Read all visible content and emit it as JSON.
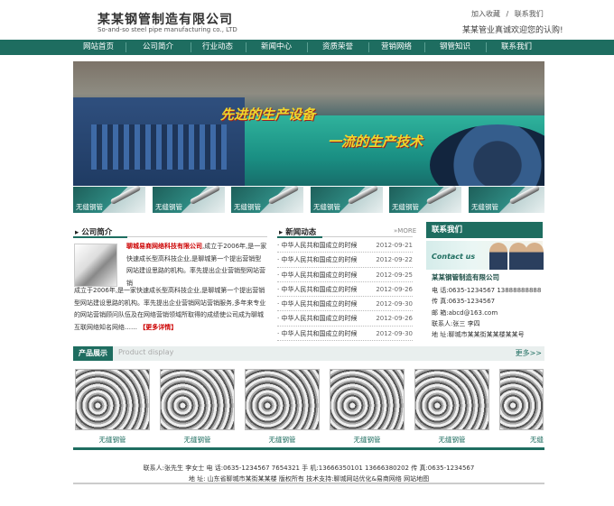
{
  "header": {
    "logo_cn": "某某钢管制造有限公司",
    "logo_en": "So-and-so steel pipe manufacturing co., LTD",
    "top_links": [
      "加入收藏",
      "/",
      "联系我们"
    ],
    "slogan": "某某管业真诚欢迎您的认购!"
  },
  "nav": [
    "网站首页",
    "公司简介",
    "行业动态",
    "新闻中心",
    "资质荣誉",
    "营销网络",
    "钢管知识",
    "联系我们"
  ],
  "banner": {
    "text1": "先进的生产设备",
    "text2": "一流的生产技术"
  },
  "thumbs": [
    "无缝钢管",
    "无缝钢管",
    "无缝钢管",
    "无缝钢管",
    "无缝钢管",
    "无缝钢管"
  ],
  "about": {
    "title": "公司简介",
    "name": "聊城易商网络科技有限公司",
    "text_a": ",成立于2006年,是一家快速成长型高科技企业,是聊城第一个提出营销型网站建设思路的机构。率先提出企业营销型网站营销",
    "text_b": "成立于2006年,是一家快速成长型高科技企业,是聊城第一个提出营销型网站建设思路的机构。率先提出企业营销网站营销服务,多年来专业的网站营销顾问队伍及在网络营销领域所取得的成绩使公司成为聊城互联网络知名网络……",
    "more": "【更多详情】"
  },
  "news": {
    "title": "新闻动态",
    "more": "MORE",
    "items": [
      {
        "text": "· 中华人民共和国成立的时候",
        "date": "2012-09-21"
      },
      {
        "text": "· 中华人民共和国成立的时候",
        "date": "2012-09-22"
      },
      {
        "text": "· 中华人民共和国成立的时候",
        "date": "2012-09-25"
      },
      {
        "text": "· 中华人民共和国成立的时候",
        "date": "2012-09-26"
      },
      {
        "text": "· 中华人民共和国成立的时候",
        "date": "2012-09-30"
      },
      {
        "text": "· 中华人民共和国成立的时候",
        "date": "2012-09-26"
      },
      {
        "text": "· 中华人民共和国成立的时候",
        "date": "2012-09-30"
      }
    ]
  },
  "contact": {
    "title": "联系我们",
    "img_text": "Contact us",
    "company": "某某钢管制造有限公司",
    "phone": "电    话:0635-1234567  13888888888",
    "fax": "传    真:0635-1234567",
    "email": "邮    箱:abcd@163.com",
    "person": "联系人:张三   李四",
    "address": "地    址:聊城市某某街某某楼某某号"
  },
  "products": {
    "title": "产品展示",
    "en": "Product display",
    "more": "更多>>",
    "items": [
      "无缝钢管",
      "无缝钢管",
      "无缝钢管",
      "无缝钢管",
      "无缝钢管",
      "无缝"
    ]
  },
  "footer": {
    "line1": "联系人:张先生 李女士   电 话:0635-1234567 7654321  手 机:13666350101 13666380202   传 真:0635-1234567",
    "line2": "地 址: 山东省聊城市某街某某楼   版权所有  技术支持:聊城网站优化&易商网络   网站地图"
  }
}
